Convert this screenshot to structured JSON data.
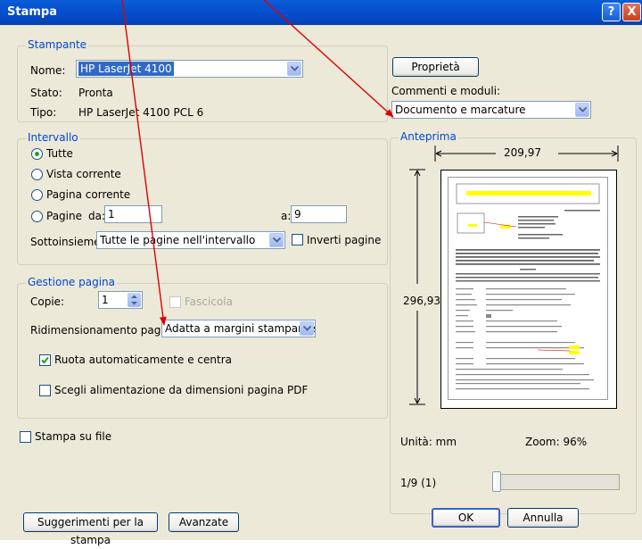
{
  "window": {
    "title": "Stampa",
    "help_glyph": "?",
    "close_glyph": "X"
  },
  "printer": {
    "legend": "Stampante",
    "name_label": "Nome:",
    "name_value": "HP LaserJet 4100",
    "status_label": "Stato:",
    "status_value": "Pronta",
    "type_label": "Tipo:",
    "type_value": "HP LaserJet 4100 PCL 6",
    "properties_button": "Proprietà",
    "comments_label": "Commenti e moduli:",
    "comments_value": "Documento e marcature"
  },
  "range": {
    "legend": "Intervallo",
    "all": "Tutte",
    "current_view": "Vista corrente",
    "current_page": "Pagina corrente",
    "pages": "Pagine",
    "from_label": "da:",
    "from_value": "1",
    "to_label": "a:",
    "to_value": "9",
    "subset_label": "Sottoinsieme:",
    "subset_value": "Tutte le pagine nell'intervallo",
    "reverse_label": "Inverti pagine",
    "selected": "all"
  },
  "page_handling": {
    "legend": "Gestione pagina",
    "copies_label": "Copie:",
    "copies_value": "1",
    "collate_label": "Fascicola",
    "scaling_label": "Ridimensionamento pagina:",
    "scaling_value": "Adatta a margini stampante",
    "autorotate_label": "Ruota automaticamente e centra",
    "autorotate_checked": true,
    "pdf_source_label": "Scegli alimentazione da dimensioni pagina PDF",
    "pdf_source_checked": false
  },
  "print_to_file": "Stampa su file",
  "preview": {
    "legend": "Anteprima",
    "width": "209,97",
    "height": "296,93",
    "units": "Unità: mm",
    "zoom": "Zoom:  96%",
    "page_counter": "1/9 (1)"
  },
  "footer": {
    "tips_button": "Suggerimenti per la stampa",
    "advanced_button": "Avanzate",
    "ok_button": "OK",
    "cancel_button": "Annulla"
  },
  "colors": {
    "annotation_arrow": "#E00000",
    "legend_text": "#0046D5",
    "highlight": "#FFFF00"
  }
}
